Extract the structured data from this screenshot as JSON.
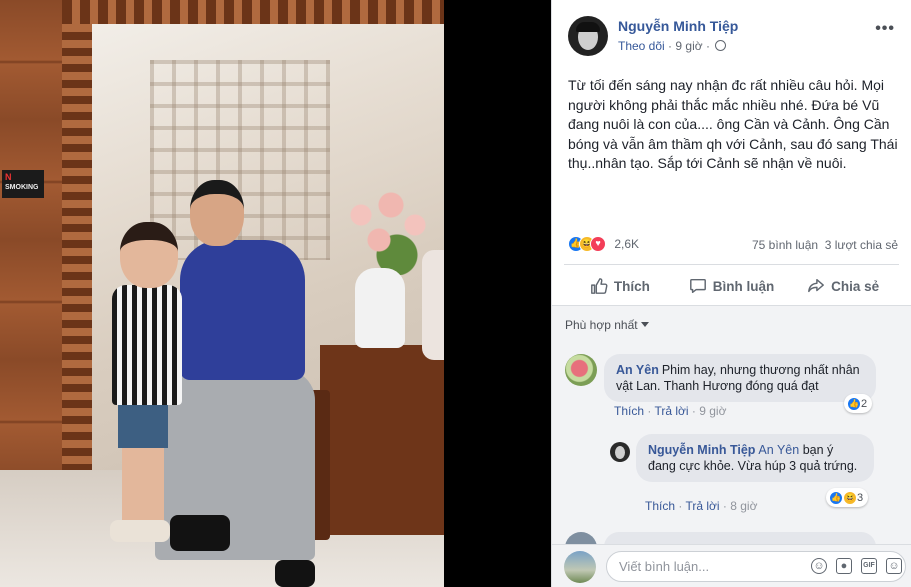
{
  "photo": {
    "sign_prefix": "N",
    "sign_word": "SMOKING"
  },
  "post": {
    "author": "Nguyễn Minh Tiệp",
    "follow": "Theo dõi",
    "separator": "·",
    "time": "9 giờ",
    "more": "•••",
    "text": "Từ tối đến sáng nay nhận đc rất nhiều câu hỏi. Mọi người không phải thắc mắc nhiều nhé. Đứa bé Vũ đang nuôi là con của.... ông Cần và Cảnh. Ông Cần bóng và vẫn âm thầm qh với Cảnh, sau đó sang Thái thụ..nhân tạo. Sắp tới Cảnh sẽ nhận về nuôi.",
    "reaction_count": "2,6K",
    "comment_count": "75 bình luận",
    "share_count": "3 lượt chia sẻ"
  },
  "actions": {
    "like": "Thích",
    "comment": "Bình luận",
    "share": "Chia sẻ"
  },
  "comments": {
    "sort_label": "Phù hợp nhất",
    "items": [
      {
        "author": "An Yên",
        "text": "Phim hay, nhưng thương nhất nhân vật Lan. Thanh Hương đóng quá đạt",
        "like": "Thích",
        "reply": "Trả lời",
        "time": "9 giờ",
        "reactions": "2"
      },
      {
        "author": "Nguyễn Minh Tiệp",
        "mention": "An Yên",
        "text": "bạn ý đang cực khỏe. Vừa húp 3 quả trứng.",
        "like": "Thích",
        "reply": "Trả lời",
        "time": "8 giờ",
        "reactions": "3"
      }
    ]
  },
  "composer": {
    "placeholder": "Viết bình luận...",
    "gif": "GIF"
  },
  "colors": {
    "link": "#365899",
    "like": "#1877f2",
    "haha": "#f7b928",
    "love": "#f33e58"
  }
}
